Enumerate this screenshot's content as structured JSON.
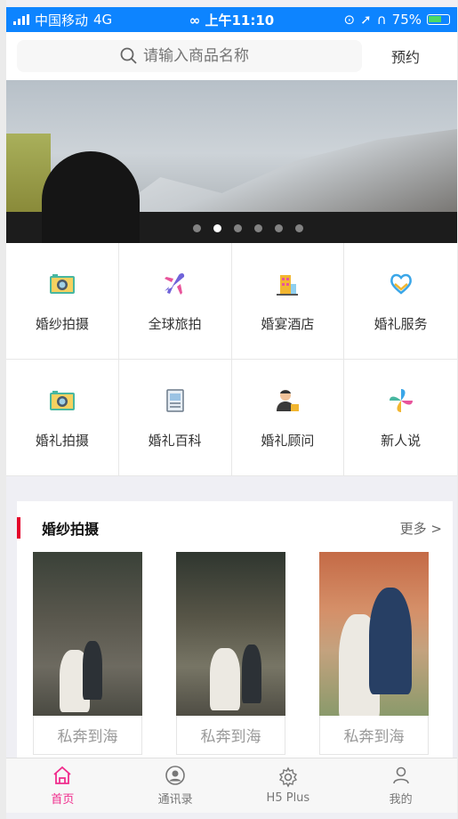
{
  "status_bar": {
    "carrier": "中国移动",
    "network": "4G",
    "time": "上午11:10",
    "battery": "75%"
  },
  "header": {
    "search_placeholder": "请输入商品名称",
    "reserve_label": "预约"
  },
  "banner": {
    "slide_count": 6,
    "active_slide": 2
  },
  "menu": [
    {
      "label": "婚纱拍摄",
      "icon": "camera-icon"
    },
    {
      "label": "全球旅拍",
      "icon": "airplane-icon"
    },
    {
      "label": "婚宴酒店",
      "icon": "hotel-icon"
    },
    {
      "label": "婚礼服务",
      "icon": "heart-service-icon"
    },
    {
      "label": "婚礼拍摄",
      "icon": "camera-icon"
    },
    {
      "label": "婚礼百科",
      "icon": "book-icon"
    },
    {
      "label": "婚礼顾问",
      "icon": "consultant-icon"
    },
    {
      "label": "新人说",
      "icon": "pinwheel-icon"
    }
  ],
  "section": {
    "title": "婚纱拍摄",
    "more": "更多 >",
    "items": [
      {
        "title": "私奔到海"
      },
      {
        "title": "私奔到海"
      },
      {
        "title": "私奔到海"
      }
    ]
  },
  "tabbar": {
    "tabs": [
      {
        "label": "首页",
        "icon": "home-icon",
        "active": true
      },
      {
        "label": "通讯录",
        "icon": "contacts-icon",
        "active": false
      },
      {
        "label": "H5 Plus",
        "icon": "gear-icon",
        "active": false
      },
      {
        "label": "我的",
        "icon": "user-icon",
        "active": false
      }
    ]
  },
  "colors": {
    "status_bar": "#0d84ff",
    "accent": "#f02c8c",
    "section_bar": "#e4002b"
  }
}
